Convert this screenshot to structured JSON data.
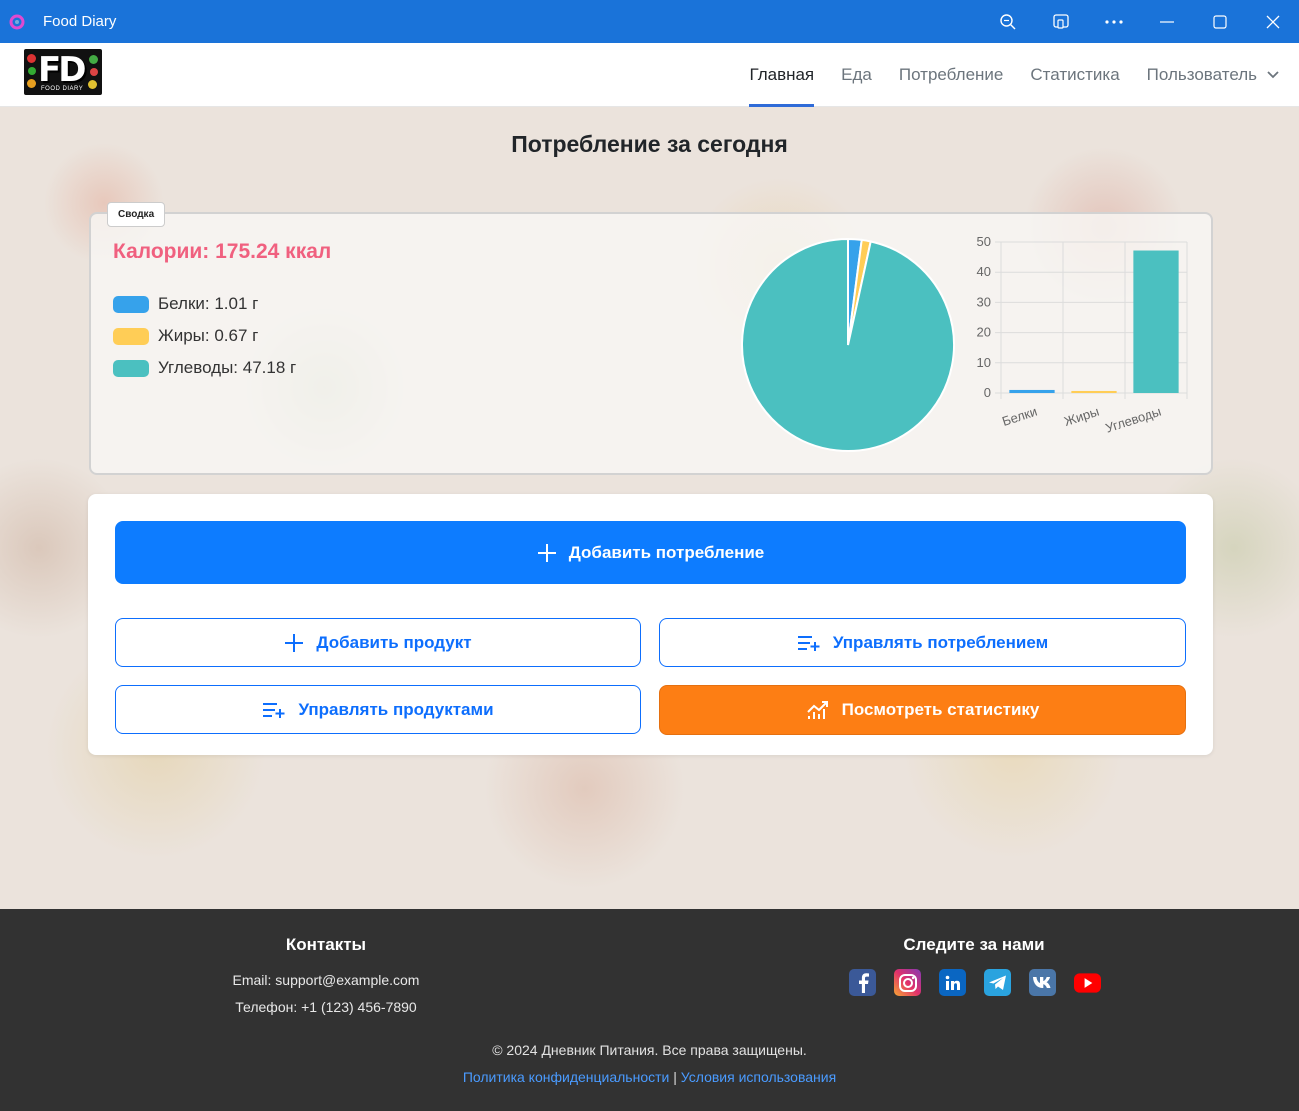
{
  "window": {
    "title": "Food Diary",
    "accent": "#1a73d9"
  },
  "navbar": {
    "logo_text": "FD",
    "logo_subtext": "FOOD DIARY",
    "links": [
      {
        "label": "Главная",
        "active": true
      },
      {
        "label": "Еда",
        "active": false
      },
      {
        "label": "Потребление",
        "active": false
      },
      {
        "label": "Статистика",
        "active": false
      },
      {
        "label": "Пользователь",
        "active": false,
        "dropdown": true
      }
    ]
  },
  "main": {
    "title": "Потребление за сегодня",
    "summary": {
      "tag": "Сводка",
      "calories": "Калории: 175.24 ккал",
      "legend": [
        {
          "label": "Белки: 1.01 г",
          "color": "#36a2eb"
        },
        {
          "label": "Жиры: 0.67 г",
          "color": "#ffcd56"
        },
        {
          "label": "Углеводы: 47.18 г",
          "color": "#4bc0c0"
        }
      ]
    },
    "actions": {
      "add_consumption": "Добавить потребление",
      "add_product": "Добавить продукт",
      "manage_consumption": "Управлять потреблением",
      "manage_products": "Управлять продуктами",
      "view_stats": "Посмотреть статистику"
    }
  },
  "chart_data": [
    {
      "type": "pie",
      "categories": [
        "Белки",
        "Жиры",
        "Углеводы"
      ],
      "values": [
        1.01,
        0.67,
        47.18
      ],
      "colors": [
        "#36a2eb",
        "#ffcd56",
        "#4bc0c0"
      ]
    },
    {
      "type": "bar",
      "categories": [
        "Белки",
        "Жиры",
        "Углеводы"
      ],
      "values": [
        1.01,
        0.67,
        47.18
      ],
      "colors": [
        "#36a2eb",
        "#ffcd56",
        "#4bc0c0"
      ],
      "ylim": [
        0,
        50
      ],
      "yticks": [
        0,
        10,
        20,
        30,
        40,
        50
      ],
      "grid": true
    }
  ],
  "footer": {
    "contacts_title": "Контакты",
    "email": "Email: support@example.com",
    "phone": "Телефон: +1 (123) 456-7890",
    "follow_title": "Следите за нами",
    "socials": [
      {
        "name": "facebook-icon",
        "color": "#3b5998"
      },
      {
        "name": "instagram-icon",
        "color": "#c13584"
      },
      {
        "name": "linkedin-icon",
        "color": "#0a66c2"
      },
      {
        "name": "telegram-icon",
        "color": "#2aa3df"
      },
      {
        "name": "vk-icon",
        "color": "#4a76a8"
      },
      {
        "name": "youtube-icon",
        "color": "#ff0000"
      }
    ],
    "copyright": "© 2024 Дневник Питания. Все права защищены.",
    "privacy": "Политика конфиденциальности",
    "separator": "|",
    "terms": "Условия использования"
  }
}
